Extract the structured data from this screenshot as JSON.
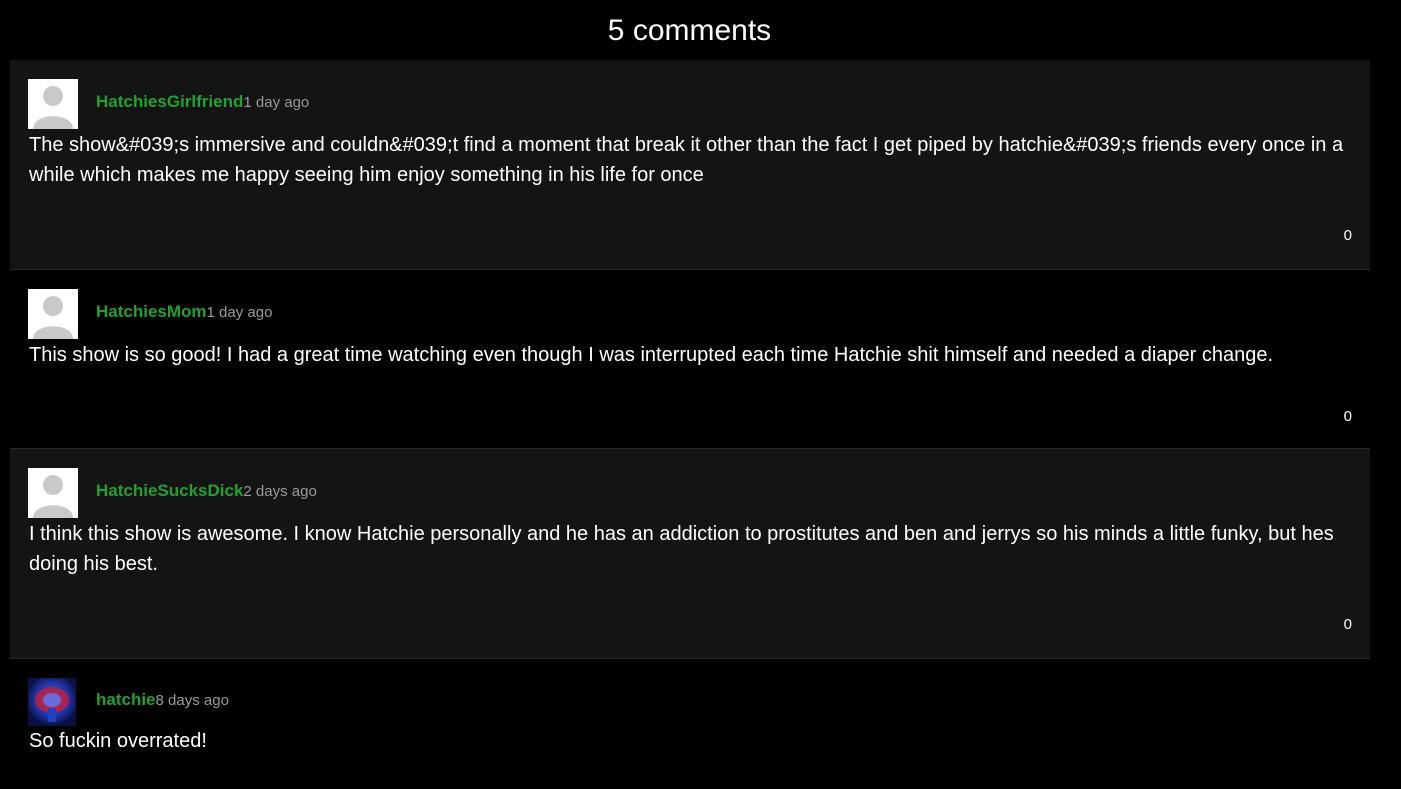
{
  "header": {
    "title": "5 comments"
  },
  "comments": [
    {
      "username": "HatchiesGirlfriend",
      "time": "1 day ago",
      "text": "The show&#039;s immersive and couldn&#039;t find a moment that break it other than the fact I get piped by hatchie&#039;s friends every once in a while which makes me happy seeing him enjoy something in his life for once",
      "votes": "0",
      "avatar": "default-avatar-icon"
    },
    {
      "username": "HatchiesMom",
      "time": "1 day ago",
      "text": "This show is so good! I had a great time watching even though I was interrupted each time Hatchie shit himself and needed a diaper change.",
      "votes": "0",
      "avatar": "default-avatar-icon"
    },
    {
      "username": "HatchieSucksDick",
      "time": "2 days ago",
      "text": "I think this show is awesome. I know Hatchie personally and he has an addiction to prostitutes and ben and jerrys so his minds a little funky, but hes doing his best.",
      "votes": "0",
      "avatar": "default-avatar-icon"
    },
    {
      "username": "hatchie",
      "time": "8 days ago",
      "text": "So fuckin overrated!",
      "votes": "",
      "avatar": "user-photo-avatar"
    }
  ],
  "colors": {
    "username": "#1fa22e",
    "time": "#9a9a9a",
    "panel_odd": "#141414",
    "panel_even": "#000000"
  }
}
